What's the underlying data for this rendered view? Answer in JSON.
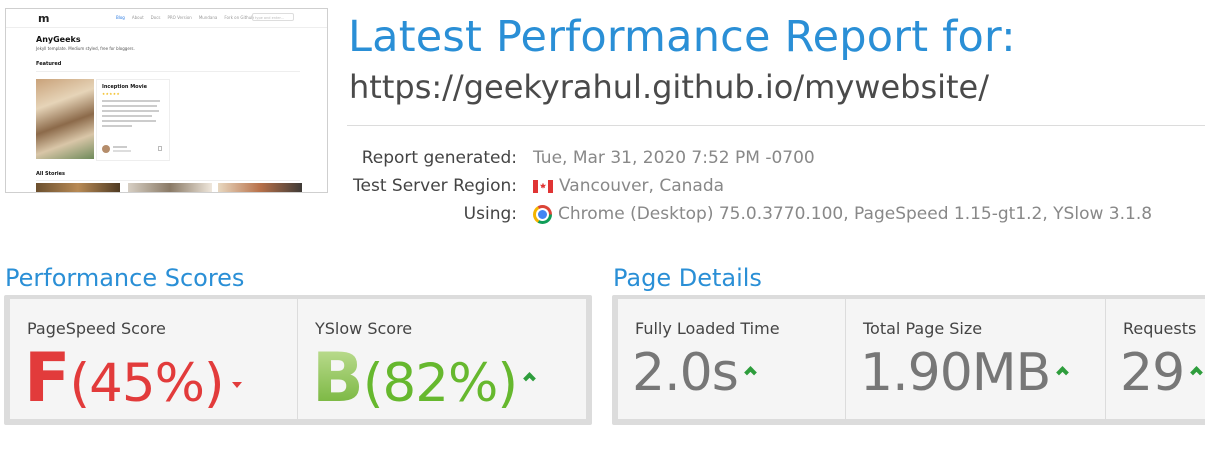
{
  "thumbnail": {
    "logo": "m",
    "nav": [
      "Blog",
      "About",
      "Docs",
      "PRO Version",
      "Mundana",
      "Fork on Github"
    ],
    "search_placeholder": "type and enter...",
    "site_title": "AnyGeeks",
    "site_description": "Jekyll template. Medium styled, free for bloggers.",
    "featured_label": "Featured",
    "featured_post_title": "Inception Movie",
    "all_stories_label": "All Stories"
  },
  "header": {
    "title": "Latest Performance Report for:",
    "url": "https://geekyrahul.github.io/mywebsite/"
  },
  "meta": {
    "report_generated_label": "Report generated:",
    "report_generated_value": "Tue, Mar 31, 2020 7:52 PM -0700",
    "region_label": "Test Server Region:",
    "region_value": "Vancouver, Canada",
    "region_icon": "canada-flag-icon",
    "using_label": "Using:",
    "using_value": "Chrome (Desktop) 75.0.3770.100, PageSpeed 1.15-gt1.2, YSlow 3.1.8",
    "using_icon": "chrome-icon"
  },
  "performance_scores": {
    "heading": "Performance Scores",
    "pagespeed": {
      "label": "PageSpeed Score",
      "grade": "F",
      "percent": "(45%)",
      "trend": "down"
    },
    "yslow": {
      "label": "YSlow Score",
      "grade": "B",
      "percent": "(82%)",
      "trend": "up"
    }
  },
  "page_details": {
    "heading": "Page Details",
    "fully_loaded": {
      "label": "Fully Loaded Time",
      "value": "2.0s",
      "trend": "up"
    },
    "page_size": {
      "label": "Total Page Size",
      "value": "1.90MB",
      "trend": "up"
    },
    "requests": {
      "label": "Requests",
      "value": "29",
      "trend": "up"
    }
  },
  "colors": {
    "accent_blue": "#2a8fd6",
    "grade_red": "#e23b3b",
    "grade_green": "#66b82e",
    "trend_up_green": "#2e9d3c"
  }
}
